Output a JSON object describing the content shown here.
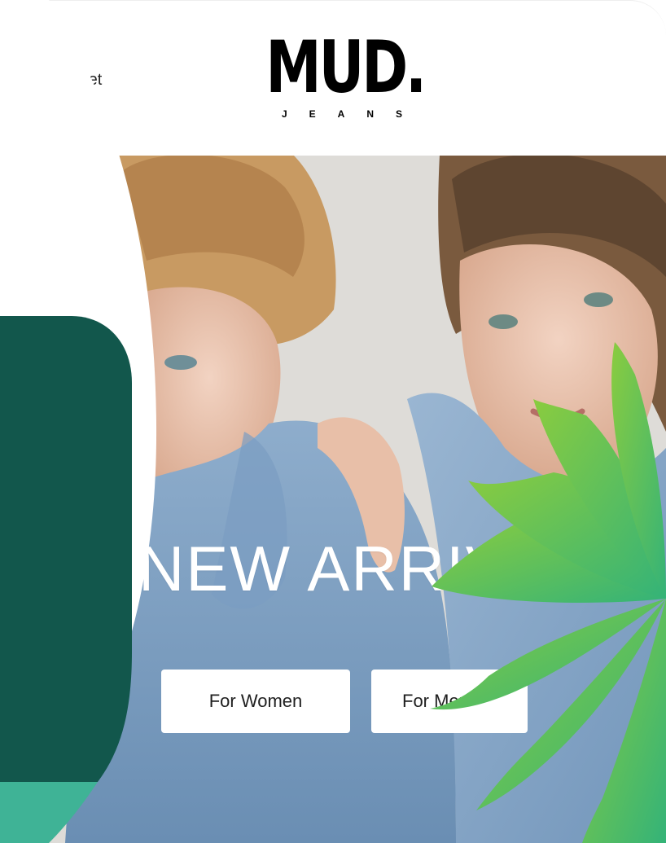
{
  "header": {
    "nav_link": "Outlet",
    "logo_main": "MUD.",
    "logo_sub": "JEANS"
  },
  "hero": {
    "title": "NEW ARRIVALS",
    "cta_women": "For Women",
    "cta_men": "For Men"
  },
  "colors": {
    "teal_dark": "#12574c",
    "teal_light": "#3fb396",
    "leaf_green": "#7ac843"
  },
  "icons": {
    "decoration": "leaf-burst-icon"
  }
}
